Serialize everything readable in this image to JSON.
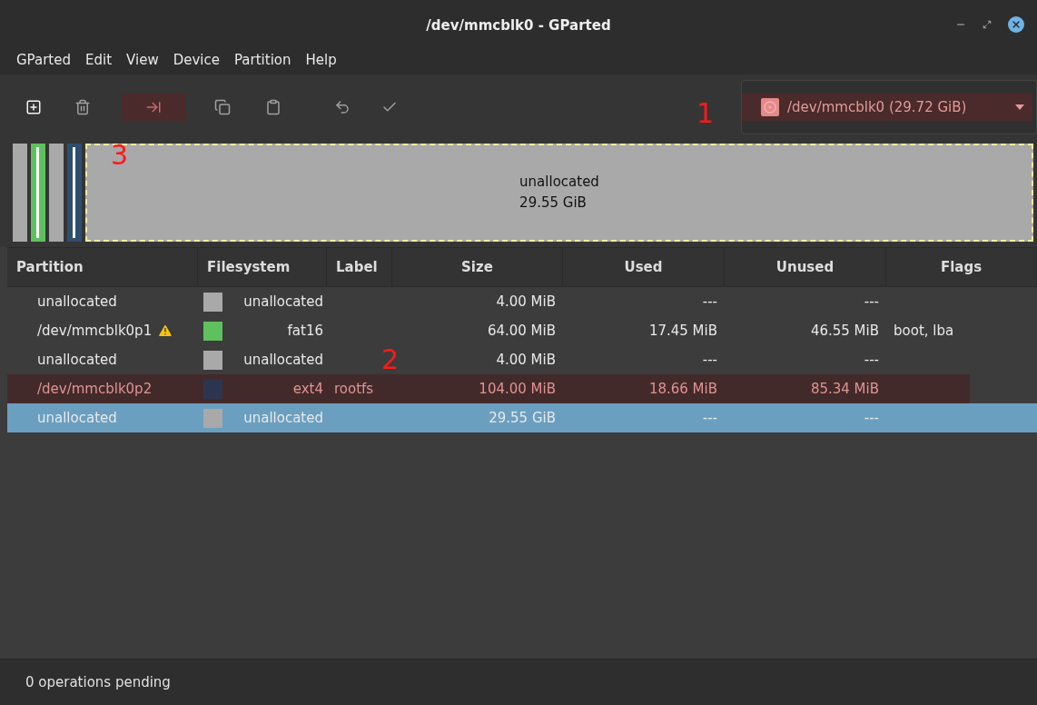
{
  "window": {
    "title": "/dev/mmcblk0 - GParted"
  },
  "menu": [
    "GParted",
    "Edit",
    "View",
    "Device",
    "Partition",
    "Help"
  ],
  "toolbar": [
    {
      "kind": "new",
      "disabled": false,
      "highlighted": false
    },
    {
      "kind": "delete",
      "disabled": true,
      "highlighted": false
    },
    {
      "kind": "resize",
      "disabled": true,
      "highlighted": true
    },
    {
      "kind": "copy",
      "disabled": true,
      "highlighted": false
    },
    {
      "kind": "paste",
      "disabled": true,
      "highlighted": false
    },
    {
      "kind": "undo",
      "disabled": true,
      "highlighted": false
    },
    {
      "kind": "apply",
      "disabled": true,
      "highlighted": false
    }
  ],
  "device_selector": {
    "value": "/dev/mmcblk0  (29.72 GiB)",
    "highlighted": true
  },
  "disk_map": [
    {
      "color": "#a9a9a9",
      "selected": false
    },
    {
      "color": "#5ec15e",
      "selected": false
    },
    {
      "color": "#a9a9a9",
      "selected": false
    },
    {
      "color": "#2e4e6e",
      "selected": false
    },
    {
      "color": "#a9a9a9",
      "selected": true,
      "name": "unallocated",
      "size": "29.55 GiB"
    }
  ],
  "table": {
    "columns": [
      "Partition",
      "Filesystem",
      "Label",
      "Size",
      "Used",
      "Unused",
      "Flags"
    ],
    "rows": [
      {
        "partition": "unallocated",
        "warning": false,
        "color": "#a9a9a9",
        "filesystem": "unallocated",
        "size": "4.00 MiB",
        "used": "---",
        "unused": "---",
        "selected": false,
        "highlighted": false
      },
      {
        "partition": "/dev/mmcblk0p1",
        "warning": true,
        "color": "#5ec15e",
        "filesystem": "fat16",
        "size": "64.00 MiB",
        "used": "17.45 MiB",
        "unused": "46.55 MiB",
        "flags": "boot, lba",
        "selected": false,
        "highlighted": false
      },
      {
        "partition": "unallocated",
        "warning": false,
        "color": "#a9a9a9",
        "filesystem": "unallocated",
        "size": "4.00 MiB",
        "used": "---",
        "unused": "---",
        "selected": false,
        "highlighted": false
      },
      {
        "partition": "/dev/mmcblk0p2",
        "warning": false,
        "color": "#2c3550",
        "filesystem": "ext4",
        "label": "rootfs",
        "size": "104.00 MiB",
        "used": "18.66 MiB",
        "unused": "85.34 MiB",
        "selected": false,
        "highlighted": true
      },
      {
        "partition": "unallocated",
        "warning": false,
        "color": "#a9a9a9",
        "filesystem": "unallocated",
        "size": "29.55 GiB",
        "used": "---",
        "unused": "---",
        "selected": true,
        "highlighted": false
      }
    ]
  },
  "status_bar": "0 operations pending",
  "annotations": [
    "1",
    "2",
    "3"
  ]
}
